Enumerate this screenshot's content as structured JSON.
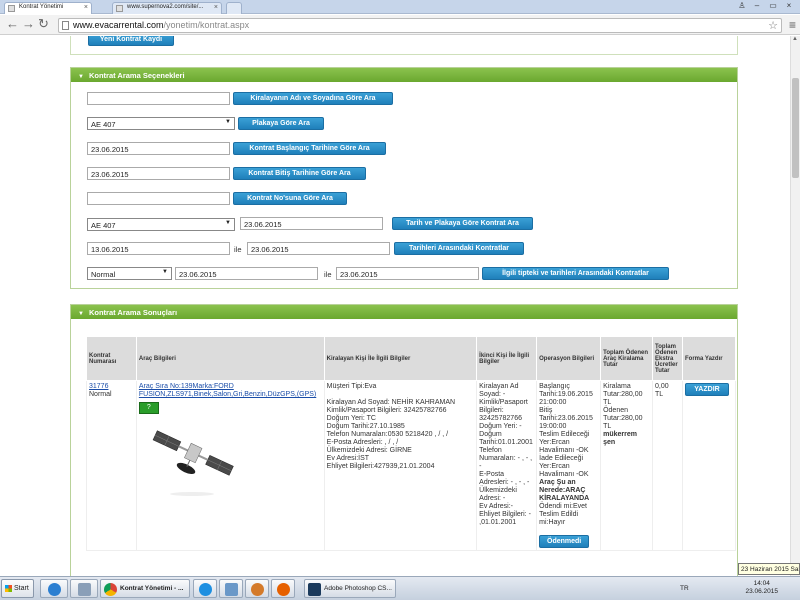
{
  "browser": {
    "tabs": [
      {
        "title": "Kontrat Yönetimi",
        "active": true
      },
      {
        "title": "www.supernova2.com/site/...",
        "active": false
      }
    ],
    "url_domain": "www.evacarrental.com",
    "url_path": "/yonetim/kontrat.aspx"
  },
  "top_button": "Yeni Kontrat Kaydı",
  "search_panel": {
    "title": "Kontrat Arama Seçenekleri",
    "rows": [
      {
        "input": "",
        "button": "Kiralayanın Adı ve Soyadına Göre Ara"
      },
      {
        "select": "AE 407",
        "button": "Plakaya Göre Ara"
      },
      {
        "input": "23.06.2015",
        "button": "Kontrat Başlangıç Tarihine Göre Ara"
      },
      {
        "input": "23.06.2015",
        "button": "Kontrat Bitiş Tarihine Göre Ara"
      },
      {
        "input": "",
        "button": "Kontrat No'suna Göre Ara"
      },
      {
        "select": "AE 407",
        "input": "23.06.2015",
        "button": "Tarih ve Plakaya Göre Kontrat Ara"
      },
      {
        "input1": "13.06.2015",
        "sep": "ile",
        "input2": "23.06.2015",
        "button": "Tarihleri Arasındaki Kontratlar"
      },
      {
        "select": "Normal",
        "input1": "23.06.2015",
        "sep": "ile",
        "input2": "23.06.2015",
        "button": "İlgili tipteki ve tarihleri Arasındaki Kontratlar"
      }
    ]
  },
  "results_panel": {
    "title": "Kontrat Arama Sonuçları",
    "headers": [
      "Kontrat Numarası",
      "Araç Bilgileri",
      "Kiralayan Kişi İle İlgili Bilgiler",
      "İkinci Kişi İle İlgili Bilgiler",
      "Operasyon Bilgileri",
      "Toplam Ödenen Araç Kiralama Tutar",
      "Toplam Ödenen Ekstra Ücretler Tutar",
      "Forma Yazdır"
    ],
    "row": {
      "contract_no": "31776",
      "contract_type": "Normal",
      "vehicle_link": "Araç Sıra No:139Marka:FORD FUSION,ZLS971,Binek,Salon,Gri,Benzin,DüzGPS,(GPS)",
      "vehicle_icon_text": "?",
      "renter": [
        "Müşteri Tipi:Eva",
        "",
        "Kiralayan Ad Soyad: NEHİR KAHRAMAN",
        "Kimlik/Pasaport Bilgileri: 32425782766",
        "Doğum Yeri: TC",
        "Doğum Tarihi:27.10.1985",
        "Telefon Numaraları:0530 5218420 , / , /",
        "E-Posta Adresleri: , / , /",
        "Ülkemizdeki Adresi: GİRNE",
        "Ev Adresi:İST",
        "Ehliyet Bilgileri:427939,21.01.2004"
      ],
      "second": [
        "Kiralayan Ad",
        "Soyad: -",
        "Kimlik/Pasaport",
        "Bilgileri:",
        "32425782766",
        "Doğum Yeri: -",
        "Doğum",
        "Tarihi:01.01.2001",
        "Telefon",
        "Numaraları: - , - ,",
        "-",
        "E-Posta",
        "Adresleri: - , - , -",
        "Ülkemizdeki",
        "Adresi: -",
        "Ev Adresi:-",
        "Ehliyet Bilgileri: -",
        ",01.01.2001"
      ],
      "operation": [
        "Başlangıç",
        "Tarihi:19.06.2015",
        "21:00:00",
        "Bitiş",
        "Tarihi:23.06.2015",
        "19:00:00",
        "Teslim Edileceği",
        "Yer:Ercan",
        "Havalimanı -OK",
        "İade Edileceği",
        "Yer:Ercan",
        "Havalimanı -OK"
      ],
      "operation_bold": "Araç Şu an Nerede:ARAÇ KİRALAYANDA",
      "operation_tail": [
        "Ödendi mi:Evet",
        "Teslim Edildi",
        "mi:Hayır"
      ],
      "operation_button": "Ödenmedi",
      "rental_total": [
        "Kiralama",
        "Tutar:280,00",
        "TL",
        "Ödenen",
        "Tutar:280,00",
        "TL"
      ],
      "rental_customer": "mükerrem şen",
      "extra_total": [
        "0,00",
        "TL"
      ],
      "print_button": "YAZDIR"
    }
  },
  "taskbar": {
    "start": "Start",
    "active_app": "Kontrat Yönetimi - ...",
    "photoshop": "Adobe Photoshop CS...",
    "lang": "TR",
    "time": "14:04",
    "date": "23.06.2015",
    "tooltip": "23 Haziran 2015 Salı"
  }
}
